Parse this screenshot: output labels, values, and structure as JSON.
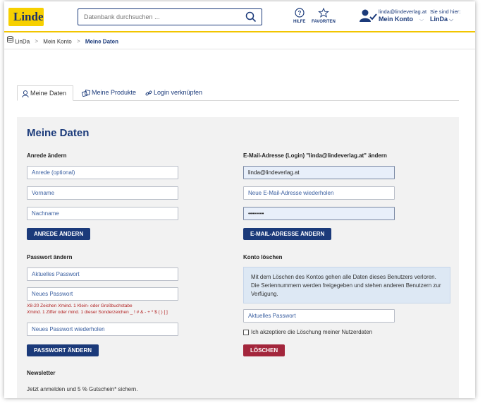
{
  "header": {
    "logo_text": "Linde",
    "search_placeholder": "Datenbank durchsuchen ...",
    "help_label": "HILFE",
    "favorites_label": "FAVORITEN",
    "account_email": "linda@lindeverlag.at",
    "account_label": "Mein Konto",
    "site_hint": "Sie sind hier:",
    "site_name": "LinDa"
  },
  "breadcrumb": [
    "LinDa",
    "Mein Konto",
    "Meine Daten"
  ],
  "tabs": [
    "Meine Daten",
    "Meine Produkte",
    "Login verknüpfen"
  ],
  "panel": {
    "title": "Meine Daten",
    "salutation": {
      "heading": "Anrede ändern",
      "anrede_placeholder": "Anrede (optional)",
      "vorname_placeholder": "Vorname",
      "nachname_placeholder": "Nachname",
      "button": "ANREDE ÄNDERN"
    },
    "email": {
      "heading": "E-Mail-Adresse (Login) \"linda@lindeverlag.at\" ändern",
      "current_value": "linda@lindeverlag.at",
      "repeat_placeholder": "Neue E-Mail-Adresse wiederholen",
      "password_value": "••••••••",
      "button": "E-MAIL-ADRESSE ÄNDERN"
    },
    "password": {
      "heading": "Passwort ändern",
      "current_placeholder": "Aktuelles Passwort",
      "new_placeholder": "Neues Passwort",
      "rule_1": "8-20 Zeichen",
      "rule_2": "mind. 1 Klein- oder Großbuchstabe",
      "rule_3": "mind. 1 Ziffer oder mind. 1 dieser Sonderzeichen _ ! # & - + * $ ( ) [ ]",
      "repeat_placeholder": "Neues Passwort wiederholen",
      "button": "PASSWORT ÄNDERN"
    },
    "delete": {
      "heading": "Konto löschen",
      "info": "Mit dem Löschen des Kontos gehen alle Daten dieses Benutzers verloren. Die Seriennummern werden freigegeben und stehen anderen Benutzern zur Verfügung.",
      "password_placeholder": "Aktuelles Passwort",
      "consent": "Ich akzeptiere die Löschung meiner Nutzerdaten",
      "button": "LÖSCHEN"
    },
    "newsletter": {
      "heading": "Newsletter",
      "text": "Jetzt anmelden und 5 % Gutschein* sichern."
    }
  },
  "colors": {
    "brand_blue": "#1b3a7a",
    "brand_yellow": "#f7d000",
    "danger_red": "#a3263c",
    "rule_red": "#b22222"
  }
}
